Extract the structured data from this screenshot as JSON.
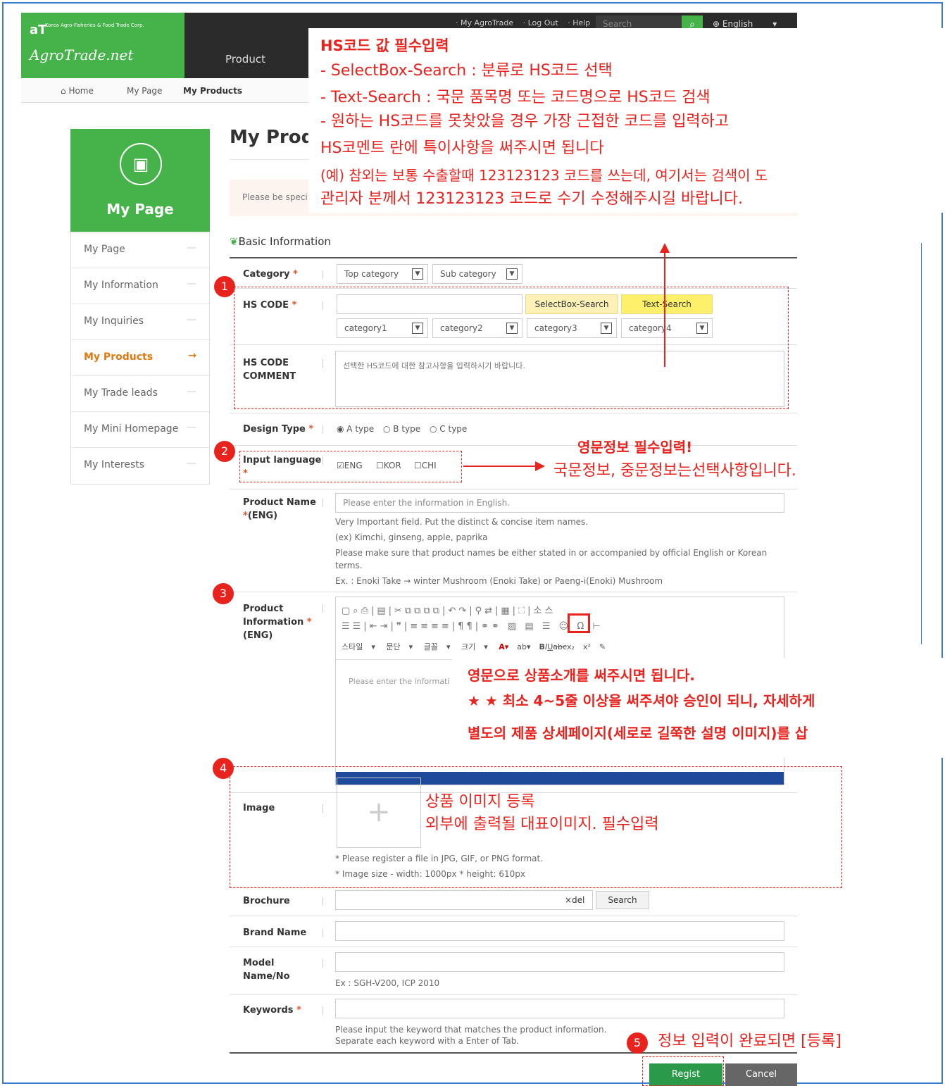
{
  "header": {
    "corp_name": "Korea Agro-Fisheries & Food Trade Corp.",
    "logo_mark": "aT",
    "brand": "AgroTrade.net",
    "links": [
      "· My AgroTrade",
      "· Log Out",
      "· Help"
    ],
    "search_placeholder": "Search",
    "language": "English",
    "menu_product": "Product"
  },
  "breadcrumb": {
    "home": "Home",
    "mypage": "My Page",
    "current": "My Products"
  },
  "sidebar": {
    "title": "My Page",
    "items": [
      {
        "label": "My Page"
      },
      {
        "label": "My Information"
      },
      {
        "label": "My Inquiries"
      },
      {
        "label": "My Products"
      },
      {
        "label": "My Trade leads"
      },
      {
        "label": "My Mini Homepage"
      },
      {
        "label": "My Interests"
      }
    ]
  },
  "main": {
    "title": "My Prod",
    "notice": "Please be speci",
    "section": "Basic Information",
    "category_label": "Category",
    "top_category": "Top category",
    "sub_category": "Sub category",
    "hscode_label": "HS CODE",
    "selectbox_search": "SelectBox-Search",
    "text_search": "Text-Search",
    "cat1": "category1",
    "cat2": "category2",
    "cat3": "category3",
    "cat4": "category4",
    "hs_comment_label_1": "HS CODE",
    "hs_comment_label_2": "COMMENT",
    "hs_comment_placeholder": "선택한 HS코드에 대한 참고사항을 입력하시기 바랍니다.",
    "design_type_label": "Design Type",
    "design_types": [
      "A type",
      "B type",
      "C type"
    ],
    "input_language_label": "Input language",
    "languages": [
      "ENG",
      "KOR",
      "CHI"
    ],
    "product_name_label_1": "Product Name",
    "product_name_label_2": "(ENG)",
    "product_name_placeholder": "Please enter the information in English.",
    "product_name_help": [
      "Very Important field. Put the distinct & concise item names.",
      "(ex) Kimchi, ginseng, apple, paprika",
      "Please make sure that product names be either stated in or accompanied by official English or Korean",
      "terms.",
      "Ex. : Enoki Take → winter Mushroom (Enoki Take) or Paeng-i(Enoki) Mushroom"
    ],
    "product_info_label_1": "Product",
    "product_info_label_2": "Information",
    "product_info_label_3": "(ENG)",
    "editor_source": "소스",
    "editor_style": "스타일",
    "editor_paragraph": "문단",
    "editor_font": "글꼴",
    "editor_size": "크기",
    "editor_placeholder": "Please enter the informati",
    "image_label": "Image",
    "image_help": [
      "* Please register a file in JPG, GIF, or PNG format.",
      "* Image size - width: 1000px * height: 610px"
    ],
    "brochure_label": "Brochure",
    "brochure_del": "×del",
    "brochure_search": "Search",
    "brand_label": "Brand Name",
    "model_label_1": "Model",
    "model_label_2": "Name/No",
    "model_help": "Ex : SGH-V200, ICP 2010",
    "keywords_label": "Keywords",
    "keywords_help": [
      "Please input the keyword that matches the product information.",
      "Separate each keyword with a Enter of Tab."
    ],
    "regist": "Regist",
    "cancel": "Cancel"
  },
  "annotations": {
    "hs_title": "HS코드 값 필수입력",
    "hs_lines": [
      "- SelectBox-Search : 분류로 HS코드 선택",
      "- Text-Search : 국문 품목명 또는 코드명으로 HS코드 검색",
      "- 원하는 HS코드를 못찾았을 경우 가장 근접한 코드를 입력하고",
      "  HS코멘트 란에 특이사항을 써주시면 됩니다",
      "  (예) 참외는 보통 수출할때 123123123 코드를 쓰는데, 여기서는 검색이 도",
      "관리자 분께서 123123123 코드로 수기 수정해주시길 바랍니다."
    ],
    "eng_title": "영문정보 필수입력!",
    "eng_line": "국문정보, 중문정보는선택사항입니다.",
    "editor_lines": [
      "영문으로 상품소개를 써주시면 됩니다.",
      "★ ★ 최소 4~5줄 이상을 써주셔야 승인이 되니, 자세하게",
      "별도의 제품 상세페이지(세로로 길쭉한 설명 이미지)를 삽"
    ],
    "image_lines": [
      "상품 이미지 등록",
      "외부에 출력될 대표이미지. 필수입력"
    ],
    "regist_line": "정보 입력이 완료되면 [등록]",
    "numbers": [
      "1",
      "2",
      "3",
      "4",
      "5"
    ]
  },
  "colors": {
    "brand_green": "#45b349",
    "annotation_red": "#e8231e",
    "active_orange": "#e07a10"
  }
}
